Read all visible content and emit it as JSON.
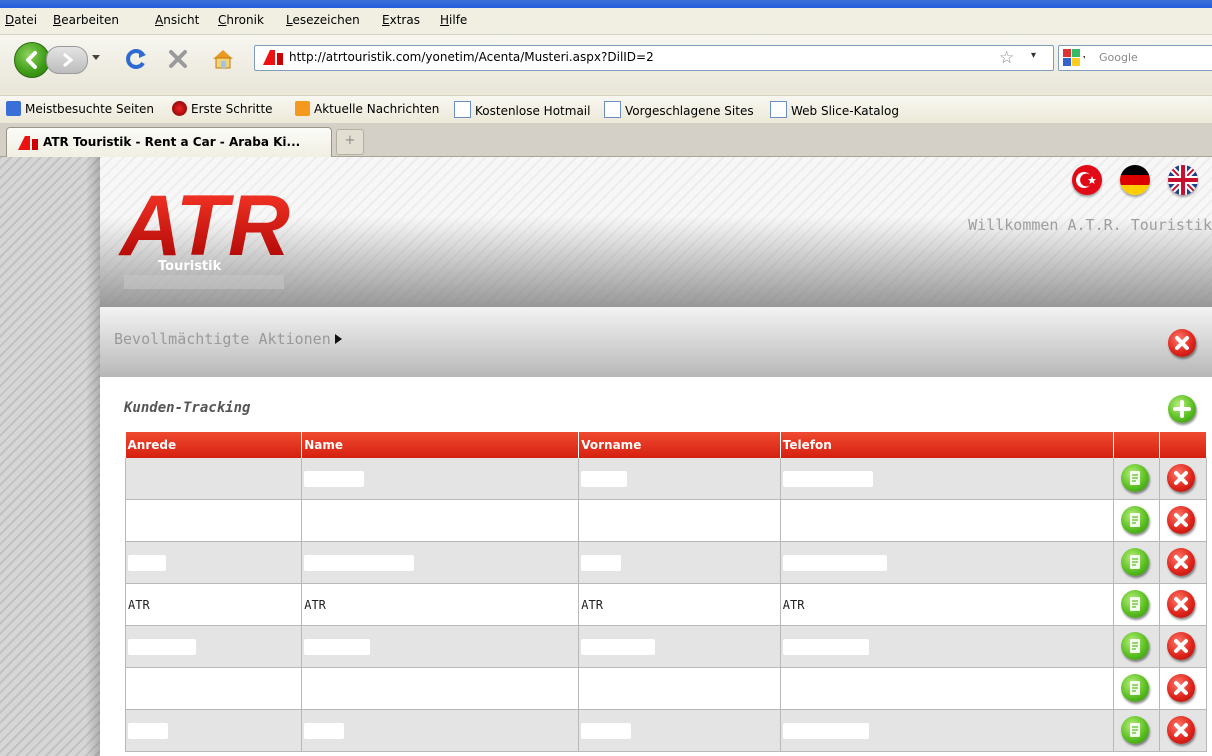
{
  "menu": [
    "Datei",
    "Bearbeiten",
    "Ansicht",
    "Chronik",
    "Lesezeichen",
    "Extras",
    "Hilfe"
  ],
  "url": "http://atrtouristik.com/yonetim/Acenta/Musteri.aspx?DilID=2",
  "search_placeholder": "Google",
  "bookmarks": [
    "Meistbesuchte Seiten",
    "Erste Schritte",
    "Aktuelle Nachrichten",
    "Kostenlose Hotmail",
    "Vorgeschlagene Sites",
    "Web Slice-Katalog"
  ],
  "tab_title": "ATR Touristik - Rent a Car - Araba Ki...",
  "new_tab_symbol": "+",
  "logo": {
    "text": "ATR",
    "subtext": "Touristik"
  },
  "welcome": "Willkommen A.T.R. Touristik",
  "actions_label": "Bevollmächtigte Aktionen",
  "panel_title": "Kunden-Tracking",
  "table": {
    "headers": [
      "Anrede",
      "Name",
      "Vorname",
      "Telefon"
    ],
    "rows": [
      {
        "anrede": "",
        "name": "",
        "vorname": "",
        "telefon": ""
      },
      {
        "anrede": "",
        "name": "",
        "vorname": "",
        "telefon": ""
      },
      {
        "anrede": "",
        "name": "",
        "vorname": "",
        "telefon": ""
      },
      {
        "anrede": "ATR",
        "name": "ATR",
        "vorname": "ATR",
        "telefon": "ATR"
      },
      {
        "anrede": "",
        "name": "",
        "vorname": "",
        "telefon": ""
      },
      {
        "anrede": "",
        "name": "",
        "vorname": "",
        "telefon": ""
      },
      {
        "anrede": "",
        "name": "",
        "vorname": "",
        "telefon": ""
      }
    ]
  },
  "colors": {
    "accent_red": "#e0251c",
    "accent_green": "#5bbf22",
    "header_row": "#f04a30"
  },
  "icons": [
    "back-icon",
    "forward-icon",
    "reload-icon",
    "stop-icon",
    "home-icon",
    "star-icon",
    "google-icon",
    "edit-icon",
    "delete-icon",
    "add-icon",
    "close-icon"
  ]
}
